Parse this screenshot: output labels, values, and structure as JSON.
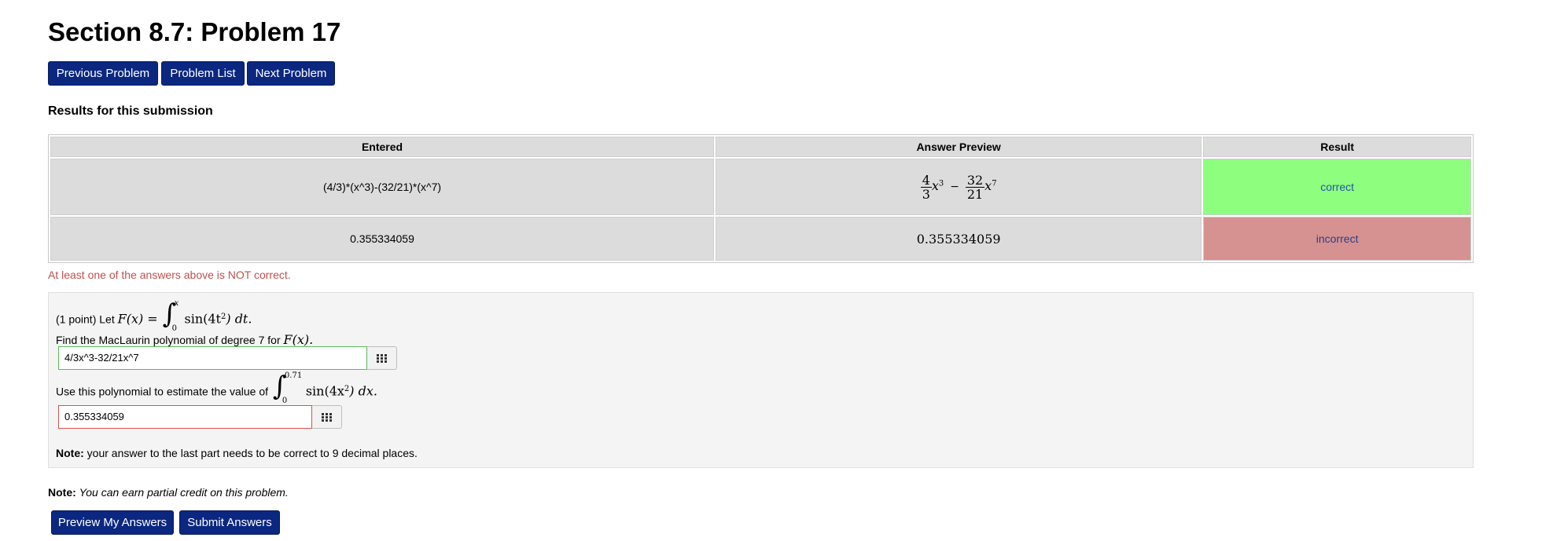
{
  "page": {
    "title": "Section 8.7: Problem 17"
  },
  "nav": {
    "previous_label": "Previous Problem",
    "list_label": "Problem List",
    "next_label": "Next Problem"
  },
  "results": {
    "heading": "Results for this submission",
    "columns": [
      "Entered",
      "Answer Preview",
      "Result"
    ],
    "rows": [
      {
        "entered": "(4/3)*(x^3)-(32/21)*(x^7)",
        "preview": {
          "n1": "4",
          "d1": "3",
          "var": "x",
          "exp1": "3",
          "minus": "−",
          "n2": "32",
          "d2": "21",
          "exp2": "7"
        },
        "result": "correct"
      },
      {
        "entered": "0.355334059",
        "preview_text": "0.355334059",
        "result": "incorrect"
      }
    ],
    "warning": "At least one of the answers above is NOT correct."
  },
  "problem": {
    "points_prefix": "(1 point) Let",
    "def_lhs": "F(x) =",
    "def_lower": "0",
    "def_upper": "x",
    "def_integrand": "sin(4t",
    "def_exp": "2",
    "def_tail": ") dt.",
    "find_text": "Find the MacLaurin polynomial of degree 7 for",
    "find_math": "F(x).",
    "answer1_value": "4/3x^3-32/21x^7",
    "use_text": "Use this polynomial to estimate the value of",
    "est_lower": "0",
    "est_upper": "0.71",
    "est_integrand": "sin(4x",
    "est_exp": "2",
    "est_tail": ") dx.",
    "answer2_value": "0.355334059",
    "note_label": "Note:",
    "note_text": " your answer to the last part needs to be correct to 9 decimal places."
  },
  "footer": {
    "note_label": "Note:",
    "note_text": "You can earn partial credit on this problem.",
    "preview_label": "Preview My Answers",
    "submit_label": "Submit Answers"
  },
  "colors": {
    "button_bg": "#0b2780",
    "correct_bg": "#8efe7e",
    "incorrect_bg": "#d69290",
    "warning_text": "#c0504d",
    "input1_border": "#5cb85c",
    "input2_border": "#d9534f"
  }
}
